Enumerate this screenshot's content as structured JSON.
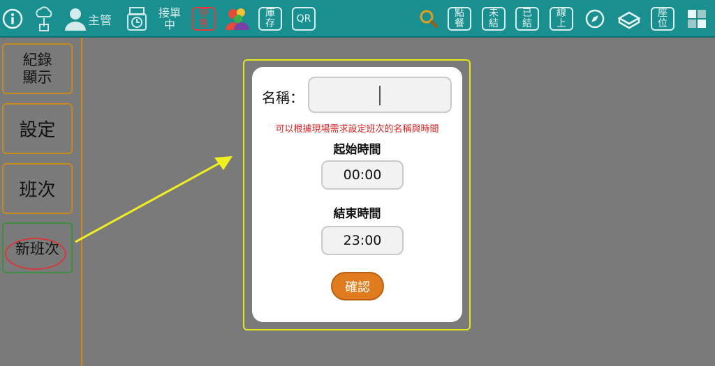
{
  "toolbar": {
    "supervisor_label": "主管",
    "take_order_line1": "接單",
    "take_order_line2": "中",
    "stop_sale_line1": "停",
    "stop_sale_line2": "售",
    "stock_line1": "庫",
    "stock_line2": "存",
    "qr_label": "QR",
    "order_line1": "點",
    "order_line2": "餐",
    "unsettled_line1": "未",
    "unsettled_line2": "結",
    "settled_line1": "已",
    "settled_line2": "結",
    "online_line1": "線",
    "online_line2": "上",
    "seat_line1": "座",
    "seat_line2": "位"
  },
  "sidebar": {
    "items": [
      {
        "label_line1": "紀錄",
        "label_line2": "顯示"
      },
      {
        "label": "設定"
      },
      {
        "label": "班次"
      },
      {
        "label": "新班次"
      }
    ]
  },
  "dialog": {
    "name_label": "名稱：",
    "name_value": "",
    "hint": "可以根據現場需求設定班次的名稱與時間",
    "start_label": "起始時間",
    "start_time": "00:00",
    "end_label": "結束時間",
    "end_time": "23:00",
    "confirm_label": "確認"
  },
  "colors": {
    "toolbar_bg": "#1a8f8f",
    "background": "#7a7a7a",
    "sidebar_border": "#c8891e",
    "highlight_oval": "#d23a3a",
    "arrow": "#f0f020",
    "hint_text": "#d42020",
    "confirm_button": "#e07b1e"
  }
}
